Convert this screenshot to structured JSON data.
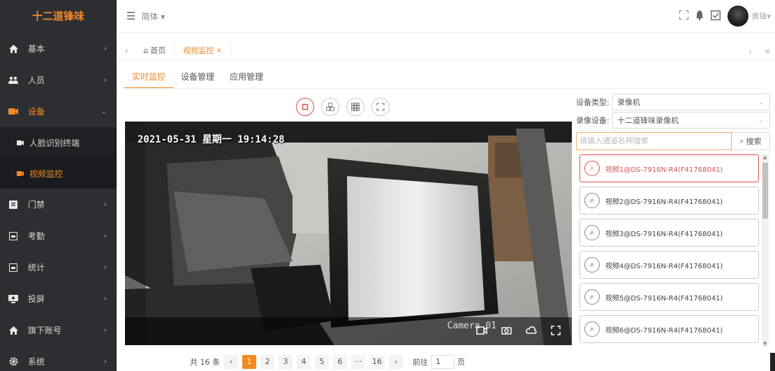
{
  "sidebar": {
    "brand": "十二道锋味",
    "items": [
      {
        "label": "基本",
        "icon": "home-icon"
      },
      {
        "label": "人员",
        "icon": "users-icon"
      },
      {
        "label": "设备",
        "icon": "camera-icon"
      },
      {
        "label": "门禁",
        "icon": "door-icon"
      },
      {
        "label": "考勤",
        "icon": "calendar-icon"
      },
      {
        "label": "统计",
        "icon": "chart-icon"
      },
      {
        "label": "投屏",
        "icon": "monitor-icon"
      },
      {
        "label": "旗下账号",
        "icon": "home-icon"
      },
      {
        "label": "系统",
        "icon": "gear-icon"
      }
    ],
    "sub_items": [
      {
        "label": "人脸识别终端"
      },
      {
        "label": "视频监控"
      }
    ]
  },
  "header": {
    "language": "简体",
    "username": "黄锋"
  },
  "tabbar": {
    "home": "首页",
    "current": "视频监控"
  },
  "page_tabs": [
    "实时监控",
    "设备管理",
    "应用管理"
  ],
  "video": {
    "timestamp": "2021-05-31 星期一 19:14:28",
    "camera_label": "Camera 01"
  },
  "pagination": {
    "total": "共 16 条",
    "pages": [
      "1",
      "2",
      "3",
      "4",
      "5",
      "6",
      "···",
      "16"
    ],
    "active": "1",
    "goto_label": "前往",
    "goto_value": "1",
    "page_suffix": "页"
  },
  "filters": {
    "device_type_label": "设备类型:",
    "device_type_value": "录像机",
    "recorder_label": "录像设备:",
    "recorder_value": "十二道锋味录像机",
    "search_placeholder": "请输入通道名称搜索",
    "search_button": "搜索"
  },
  "channels": [
    "视频1@DS-7916N-R4(F41768041)",
    "视频2@DS-7916N-R4(F41768041)",
    "视频3@DS-7916N-R4(F41768041)",
    "视频4@DS-7916N-R4(F41768041)",
    "视频5@DS-7916N-R4(F41768041)",
    "视频6@DS-7916N-R4(F41768041)"
  ],
  "colors": {
    "accent": "#f08a24",
    "sidebar_bg": "#2d2e32",
    "active_channel": "#e05050"
  }
}
